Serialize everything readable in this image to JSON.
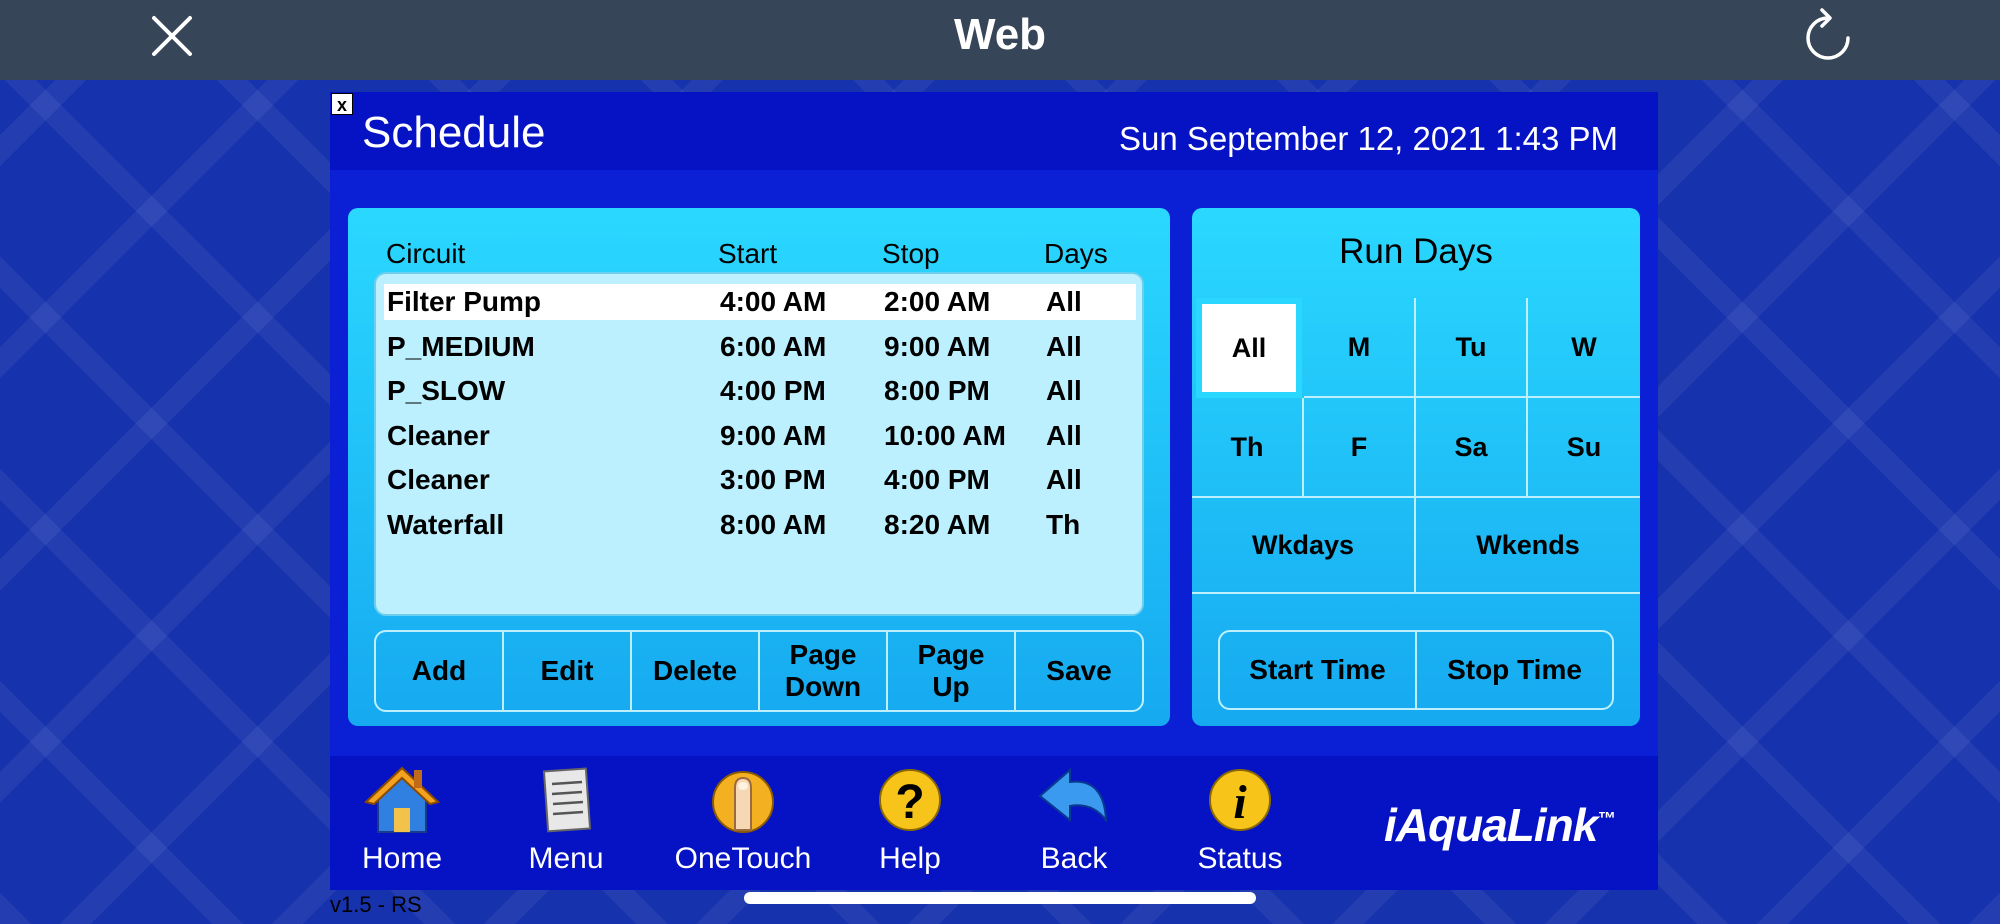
{
  "topbar": {
    "title": "Web"
  },
  "header": {
    "title": "Schedule",
    "datetime": "Sun September 12, 2021 1:43 PM"
  },
  "app_close_label": "x",
  "schedule": {
    "columns": [
      "Circuit",
      "Start",
      "Stop",
      "Days"
    ],
    "rows": [
      {
        "circuit": "Filter Pump",
        "start": "4:00 AM",
        "stop": "2:00 AM",
        "days": "All"
      },
      {
        "circuit": "P_MEDIUM",
        "start": "6:00 AM",
        "stop": "9:00 AM",
        "days": "All"
      },
      {
        "circuit": "P_SLOW",
        "start": "4:00 PM",
        "stop": "8:00 PM",
        "days": "All"
      },
      {
        "circuit": "Cleaner",
        "start": "9:00 AM",
        "stop": "10:00 AM",
        "days": "All"
      },
      {
        "circuit": "Cleaner",
        "start": "3:00 PM",
        "stop": "4:00 PM",
        "days": "All"
      },
      {
        "circuit": "Waterfall",
        "start": "8:00 AM",
        "stop": "8:20 AM",
        "days": "Th"
      }
    ],
    "buttons": {
      "add": "Add",
      "edit": "Edit",
      "delete": "Delete",
      "page_down_1": "Page",
      "page_down_2": "Down",
      "page_up_1": "Page",
      "page_up_2": "Up",
      "save": "Save"
    }
  },
  "run_days": {
    "title": "Run Days",
    "days": [
      "All",
      "M",
      "Tu",
      "W",
      "Th",
      "F",
      "Sa",
      "Su"
    ],
    "weekdays": "Wkdays",
    "weekends": "Wkends",
    "start_time": "Start Time",
    "stop_time": "Stop Time"
  },
  "nav": {
    "home": "Home",
    "menu": "Menu",
    "onetouch": "OneTouch",
    "help": "Help",
    "back": "Back",
    "status": "Status"
  },
  "brand": "iAquaLink",
  "brand_tm": "™",
  "version": "v1.5 - RS",
  "colors": {
    "panel": "#2ad8ff",
    "list": "#bdf0ff",
    "nav": "#0613c4",
    "topbar": "#374558"
  }
}
